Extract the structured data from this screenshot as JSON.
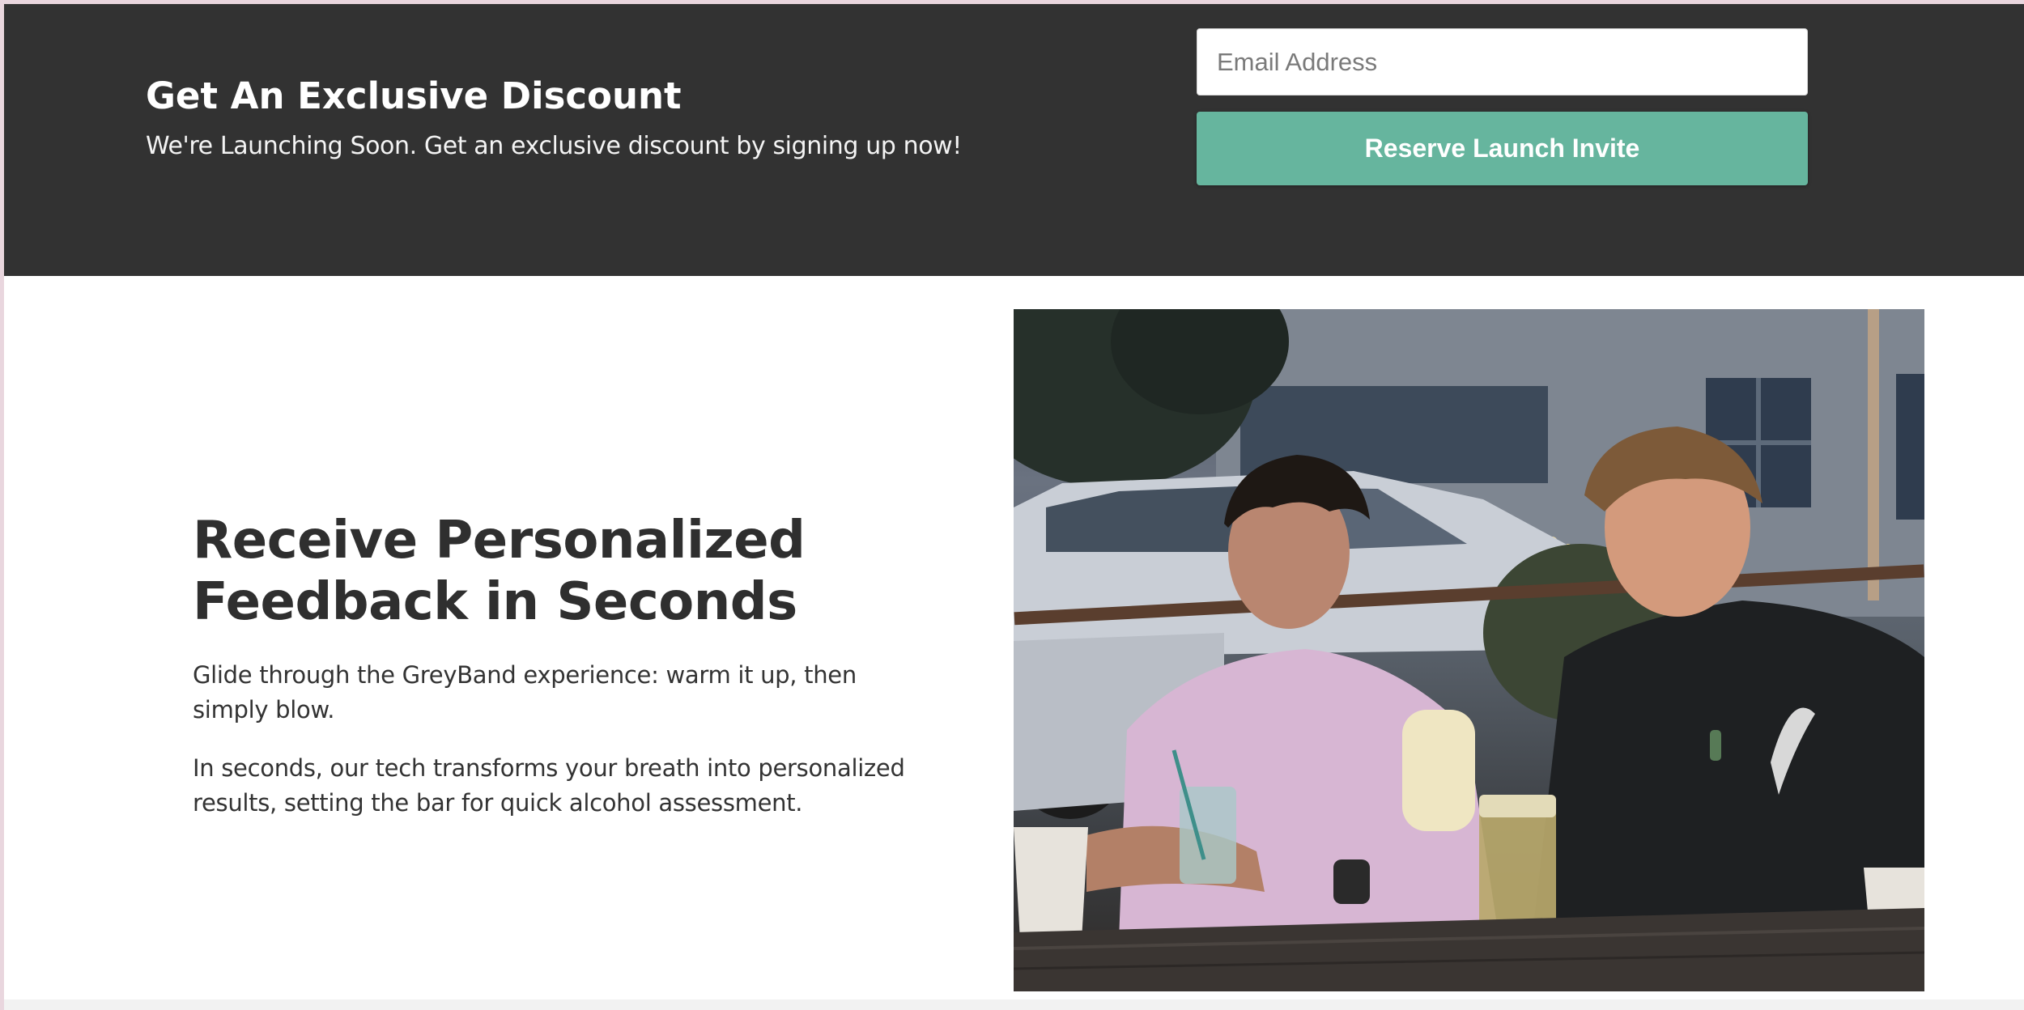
{
  "banner": {
    "title": "Get An Exclusive Discount",
    "subtitle": "We're Launching Soon. Get an exclusive discount by signing up now!",
    "email_placeholder": "Email Address",
    "button_label": "Reserve Launch Invite"
  },
  "feature": {
    "title": "Receive Personalized Feedback in Seconds",
    "paragraph1": "Glide through the GreyBand experience: warm it up, then simply blow.",
    "paragraph2": "In seconds, our tech transforms your breath into personalized results, setting the bar for quick alcohol assessment."
  },
  "colors": {
    "banner_background": "#323232",
    "button_background": "#66b59e",
    "heading_text": "#2f2f2f"
  }
}
